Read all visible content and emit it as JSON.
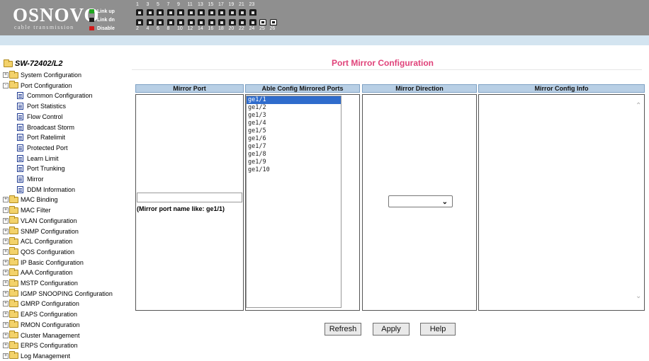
{
  "brand": {
    "logo": "OSNOVO",
    "tagline": "cable transmission"
  },
  "legend": [
    {
      "label": "Link up",
      "color": "#1fa61f"
    },
    {
      "label": "Link dn",
      "color": "#1c1c1c"
    },
    {
      "label": "Disable",
      "color": "#d11a1a"
    }
  ],
  "ports": {
    "top_numbers": [
      "1",
      "3",
      "5",
      "7",
      "9",
      "11",
      "13",
      "15",
      "17",
      "19",
      "21",
      "23"
    ],
    "bottom_numbers": [
      "2",
      "4",
      "6",
      "8",
      "10",
      "12",
      "14",
      "16",
      "18",
      "20",
      "22",
      "24",
      "25",
      "26"
    ]
  },
  "sidebar": {
    "device": "SW-72402/L2",
    "groups_before": [
      {
        "label": "System Configuration",
        "expander": "+"
      },
      {
        "label": "Port Configuration",
        "expander": "-"
      }
    ],
    "port_children": [
      {
        "label": "Common Configuration"
      },
      {
        "label": "Port Statistics"
      },
      {
        "label": "Flow Control"
      },
      {
        "label": "Broadcast Storm"
      },
      {
        "label": "Port Ratelimit"
      },
      {
        "label": "Protected Port"
      },
      {
        "label": "Learn Limit"
      },
      {
        "label": "Port Trunking"
      },
      {
        "label": "Mirror"
      },
      {
        "label": "DDM Information"
      }
    ],
    "groups_after": [
      {
        "label": "MAC Binding"
      },
      {
        "label": "MAC Filter"
      },
      {
        "label": "VLAN Configuration"
      },
      {
        "label": "SNMP Configuration"
      },
      {
        "label": "ACL Configuration"
      },
      {
        "label": "QOS Configuration"
      },
      {
        "label": "IP Basic Configuration"
      },
      {
        "label": "AAA Configuration"
      },
      {
        "label": "MSTP Configuration"
      },
      {
        "label": "IGMP SNOOPING Configuration"
      },
      {
        "label": "GMRP Configuration"
      },
      {
        "label": "EAPS Configuration"
      },
      {
        "label": "RMON Configuration"
      },
      {
        "label": "Cluster Management"
      },
      {
        "label": "ERPS Configuration"
      },
      {
        "label": "Log Management"
      }
    ]
  },
  "main": {
    "title": "Port Mirror Configuration",
    "columns": [
      "Mirror Port",
      "Able Config Mirrored Ports",
      "Mirror Direction",
      "Mirror Config Info"
    ],
    "mirror_port_value": "",
    "mirror_port_hint": "(Mirror port name like: ge1/1)",
    "ports_list": [
      "ge1/1",
      "ge1/2",
      "ge1/3",
      "ge1/4",
      "ge1/5",
      "ge1/6",
      "ge1/7",
      "ge1/8",
      "ge1/9",
      "ge1/10"
    ],
    "selected_port": "ge1/1",
    "direction_value": "",
    "buttons": {
      "refresh": "Refresh",
      "apply": "Apply",
      "help": "Help"
    }
  }
}
